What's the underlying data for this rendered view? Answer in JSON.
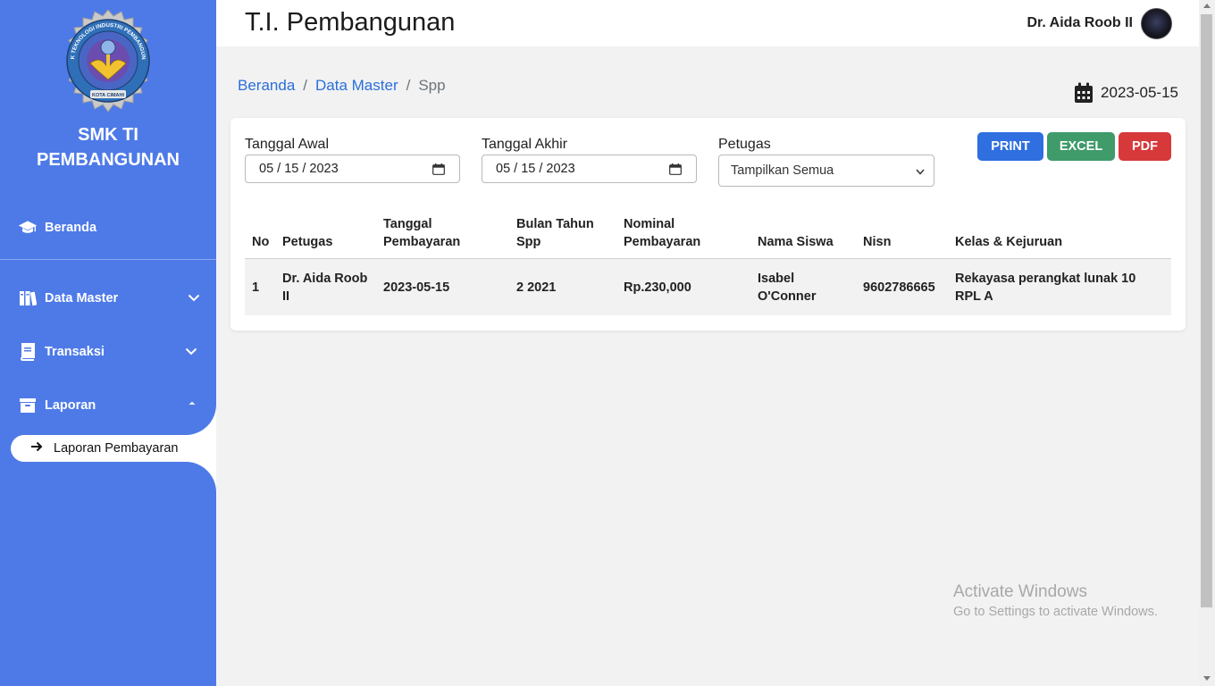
{
  "sidebar": {
    "logo_text": "SMK TEKNOLOGI INDUSTRI PEMBANGUNAN",
    "logo_subtext": "KOTA CIMAHI",
    "school_line1": "SMK TI",
    "school_line2": "PEMBANGUNAN",
    "items": [
      {
        "label": "Beranda",
        "icon": "graduation-cap-icon"
      },
      {
        "label": "Data Master",
        "icon": "book-stack-icon",
        "state": "collapsed"
      },
      {
        "label": "Transaksi",
        "icon": "book-icon",
        "state": "collapsed"
      },
      {
        "label": "Laporan",
        "icon": "archive-icon",
        "state": "expanded"
      }
    ],
    "subitem_active": "Laporan Pembayaran"
  },
  "header": {
    "title": "T.I. Pembangunan",
    "user_name": "Dr. Aida Roob II"
  },
  "breadcrumb": {
    "items": [
      "Beranda",
      "Data Master",
      "Spp"
    ],
    "separator": "/"
  },
  "current_date": "2023-05-15",
  "filters": {
    "start_label": "Tanggal Awal",
    "start_value": "05 / 15 / 2023",
    "end_label": "Tanggal Akhir",
    "end_value": "05 / 15 / 2023",
    "officer_label": "Petugas",
    "officer_selected": "Tampilkan Semua"
  },
  "buttons": {
    "print": "PRINT",
    "excel": "EXCEL",
    "pdf": "PDF"
  },
  "table": {
    "headers": {
      "no": "No",
      "petugas": "Petugas",
      "tanggal_1": "Tanggal",
      "tanggal_2": "Pembayaran",
      "bulan_1": "Bulan Tahun",
      "bulan_2": "Spp",
      "nominal_1": "Nominal",
      "nominal_2": "Pembayaran",
      "nama": "Nama Siswa",
      "nisn": "Nisn",
      "kelas": "Kelas & Kejuruan"
    },
    "rows": [
      {
        "no": "1",
        "petugas_1": "Dr. Aida Roob",
        "petugas_2": "II",
        "tanggal": "2023-05-15",
        "bulan_tahun": "2 2021",
        "nominal": "Rp.230,000",
        "nama_1": "Isabel",
        "nama_2": "O'Conner",
        "nisn": "9602786665",
        "kelas_1": "Rekayasa perangkat lunak 10",
        "kelas_2": "RPL A"
      }
    ]
  },
  "watermark": {
    "line1": "Activate Windows",
    "line2": "Go to Settings to activate Windows."
  },
  "colors": {
    "sidebar": "#4e7ae8",
    "link": "#2a6fdb",
    "print": "#2f6fe0",
    "excel": "#3f9b6a",
    "pdf": "#d7393b"
  }
}
